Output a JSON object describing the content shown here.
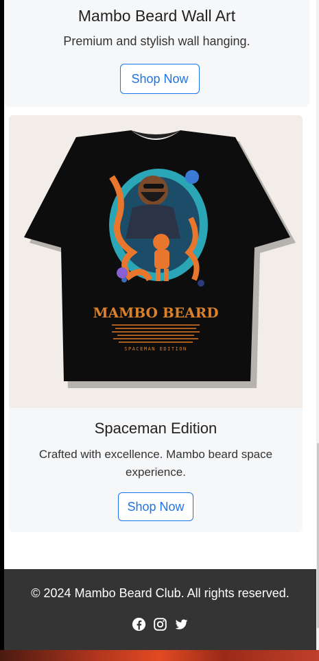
{
  "cards": [
    {
      "title": "Mambo Beard Wall Art",
      "description": "Premium and stylish wall hanging.",
      "button_label": "Shop Now"
    },
    {
      "title": "Spaceman Edition",
      "description": "Crafted with excellence. Mambo beard space experience.",
      "button_label": "Shop Now",
      "image": {
        "print_title": "MAMBO BEARD",
        "print_caption": "SPACEMAN EDITION"
      }
    }
  ],
  "footer": {
    "copyright": "© 2024 Mambo Beard Club. All rights reserved.",
    "social_icons": [
      "facebook-icon",
      "instagram-icon",
      "twitter-icon"
    ]
  },
  "colors": {
    "accent": "#1a73e8",
    "card_bg": "#f6f7f9",
    "footer_bg": "#343434",
    "image_bg": "#f2ede8"
  }
}
